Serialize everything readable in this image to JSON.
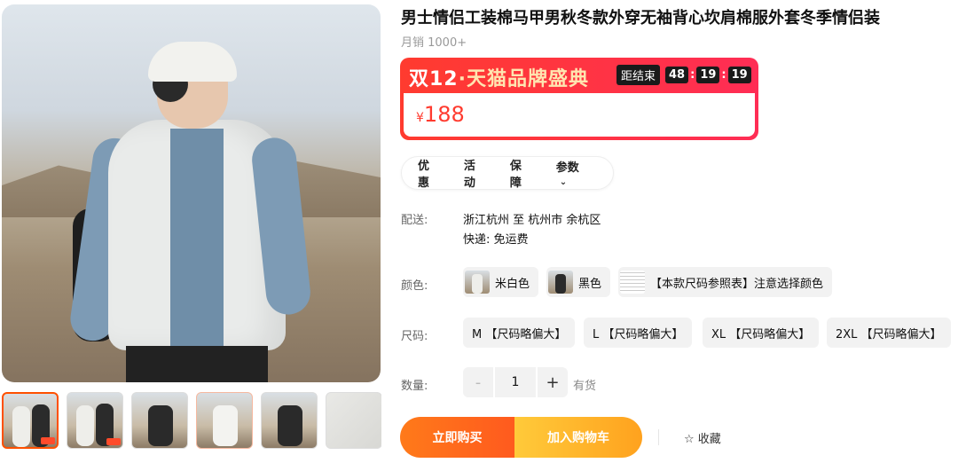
{
  "product": {
    "title": "男士情侣工装棉马甲男秋冬款外穿无袖背心坎肩棉服外套冬季情侣装",
    "sales": "月销 1000+"
  },
  "promo": {
    "brand_main": "双12",
    "brand_sub": "·天猫品牌盛典",
    "countdown_label": "距结束",
    "hours": "48",
    "minutes": "19",
    "seconds": "19",
    "currency": "¥",
    "price": "188",
    "colors": {
      "accent": "#ff3b2f",
      "badge": "#1a1a1a"
    }
  },
  "tabs": [
    "优惠",
    "活动",
    "保障",
    "参数"
  ],
  "shipping": {
    "label": "配送:",
    "route": "浙江杭州 至 杭州市 余杭区",
    "express": "快递: 免运费"
  },
  "color": {
    "label": "颜色:",
    "options": [
      "米白色",
      "黑色",
      "【本款尺码参照表】注意选择颜色"
    ]
  },
  "size": {
    "label": "尺码:",
    "options": [
      "M 【尺码略偏大】",
      "L 【尺码略偏大】",
      "XL 【尺码略偏大】",
      "2XL 【尺码略偏大】"
    ]
  },
  "quantity": {
    "label": "数量:",
    "minus": "-",
    "value": "1",
    "plus": "+",
    "stock": "有货"
  },
  "actions": {
    "buy": "立即购买",
    "cart": "加入购物车",
    "favorite": "☆ 收藏"
  },
  "icons": [
    "chevron-down-icon",
    "star-icon"
  ]
}
